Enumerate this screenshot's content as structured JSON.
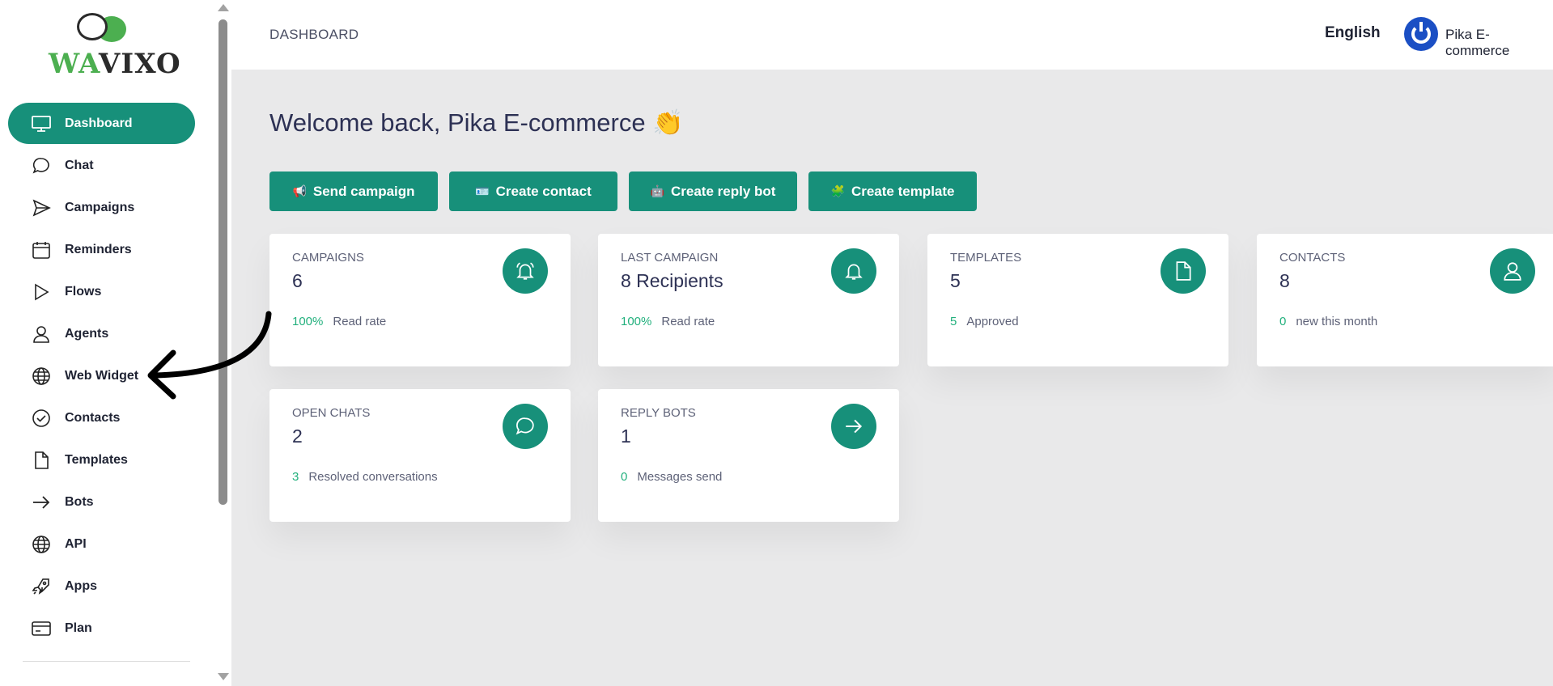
{
  "brand": {
    "part1": "WA",
    "part2": "VIXO"
  },
  "sidebar": {
    "items": [
      {
        "label": "Dashboard",
        "icon": "monitor-icon",
        "active": true
      },
      {
        "label": "Chat",
        "icon": "chat-bubble-icon"
      },
      {
        "label": "Campaigns",
        "icon": "send-icon"
      },
      {
        "label": "Reminders",
        "icon": "calendar-icon"
      },
      {
        "label": "Flows",
        "icon": "play-icon"
      },
      {
        "label": "Agents",
        "icon": "user-icon"
      },
      {
        "label": "Web Widget",
        "icon": "globe-icon"
      },
      {
        "label": "Contacts",
        "icon": "check-circle-icon"
      },
      {
        "label": "Templates",
        "icon": "file-icon"
      },
      {
        "label": "Bots",
        "icon": "arrow-right-icon"
      },
      {
        "label": "API",
        "icon": "globe-icon"
      },
      {
        "label": "Apps",
        "icon": "rocket-icon"
      },
      {
        "label": "Plan",
        "icon": "credit-card-icon"
      }
    ]
  },
  "header": {
    "breadcrumb": "DASHBOARD",
    "language": "English",
    "user_name": "Pika E-commerce"
  },
  "main": {
    "welcome": "Welcome back, Pika E-commerce 👏",
    "actions": [
      {
        "label": "Send campaign",
        "emoji": "📢"
      },
      {
        "label": "Create contact",
        "emoji": "🪪"
      },
      {
        "label": "Create reply bot",
        "emoji": "🤖"
      },
      {
        "label": "Create template",
        "emoji": "🧩"
      }
    ],
    "cards": [
      {
        "title": "CAMPAIGNS",
        "value": "6",
        "foot_num": "100%",
        "foot_text": "Read rate",
        "icon": "bell-ringing-icon"
      },
      {
        "title": "LAST CAMPAIGN",
        "value": "8 Recipients",
        "foot_num": "100%",
        "foot_text": "Read rate",
        "icon": "bell-icon"
      },
      {
        "title": "TEMPLATES",
        "value": "5",
        "foot_num": "5",
        "foot_text": "Approved",
        "icon": "file-icon"
      },
      {
        "title": "CONTACTS",
        "value": "8",
        "foot_num": "0",
        "foot_text": "new this month",
        "icon": "user-icon"
      },
      {
        "title": "OPEN CHATS",
        "value": "2",
        "foot_num": "3",
        "foot_text": "Resolved conversations",
        "icon": "chat-bubble-icon"
      },
      {
        "title": "REPLY BOTS",
        "value": "1",
        "foot_num": "0",
        "foot_text": "Messages send",
        "icon": "arrow-right-icon"
      }
    ]
  },
  "colors": {
    "accent": "#17907a",
    "positive": "#22b07d",
    "avatar": "#1b4fc4"
  }
}
